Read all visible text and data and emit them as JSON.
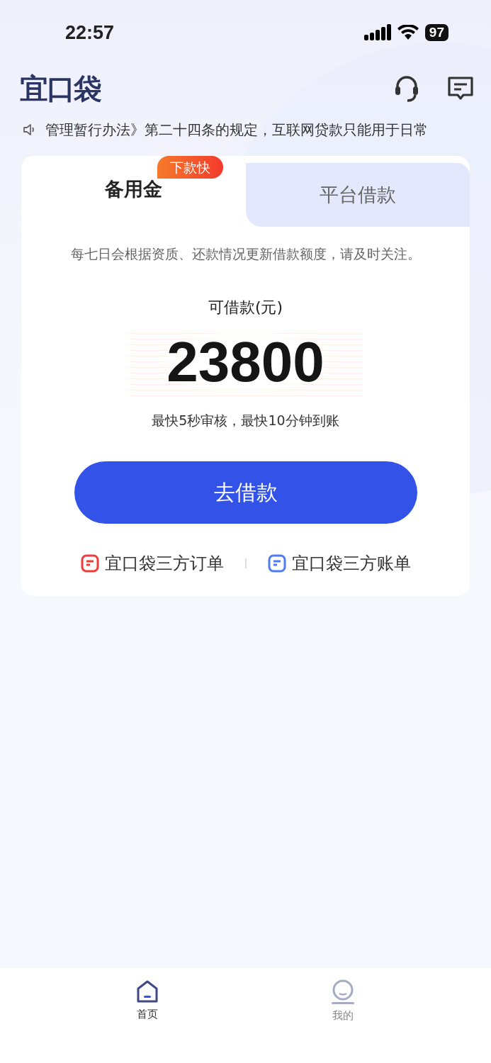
{
  "status_bar": {
    "time": "22:57",
    "battery": "97"
  },
  "header": {
    "logo": "宜口袋"
  },
  "notice": "管理暂行办法》第二十四条的规定，互联网贷款只能用于日常",
  "tabs": [
    {
      "label": "备用金",
      "selected": true,
      "badge": "下款快"
    },
    {
      "label": "平台借款",
      "selected": false
    }
  ],
  "card": {
    "hint": "每七日会根据资质、还款情况更新借款额度，请及时关注。",
    "amount_label": "可借款(元)",
    "amount": "23800",
    "speed": "最快5秒审核，最快10分钟到账",
    "button": "去借款",
    "links": [
      {
        "label": "宜口袋三方订单",
        "color": "#f23a3a"
      },
      {
        "label": "宜口袋三方账单",
        "color": "#4d7bf3"
      }
    ]
  },
  "nav": [
    {
      "label": "首页",
      "selected": true,
      "kind": "home"
    },
    {
      "label": "我的",
      "selected": false,
      "kind": "profile"
    }
  ]
}
